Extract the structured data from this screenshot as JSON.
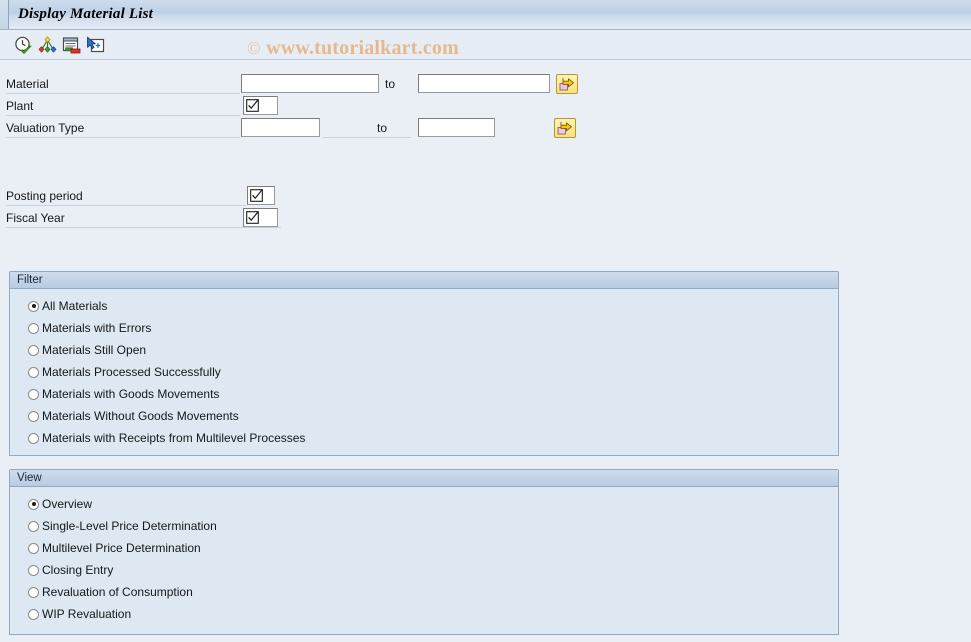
{
  "window": {
    "title": "Display Material List"
  },
  "watermark": {
    "copyright": "©",
    "text": "www.tutorialkart.com"
  },
  "toolbar": {
    "buttons": [
      {
        "name": "execute-icon",
        "tooltip": "Execute",
        "x": 13
      },
      {
        "name": "variant-colors-icon",
        "tooltip": "Get Variant",
        "x": 37
      },
      {
        "name": "save-as-variant-icon",
        "tooltip": "Save as Variant",
        "x": 61
      },
      {
        "name": "select-layout-icon",
        "tooltip": "Select Layout",
        "x": 85
      }
    ]
  },
  "selection": {
    "to_label": "to",
    "rows": [
      {
        "label": "Material",
        "type": "range",
        "from_value": "",
        "to_value": "",
        "has_multi_select": true
      },
      {
        "label": "Plant",
        "type": "checkfield",
        "value": ""
      },
      {
        "label": "Valuation Type",
        "type": "range",
        "from_value": "",
        "to_value": "",
        "has_multi_select": true
      },
      {
        "label": "Posting period",
        "type": "checkfield",
        "value": ""
      },
      {
        "label": "Fiscal Year",
        "type": "checkfield",
        "value": ""
      }
    ]
  },
  "filter_group": {
    "title": "Filter",
    "selected_index": 0,
    "options": [
      "All Materials",
      "Materials with Errors",
      "Materials Still Open",
      "Materials Processed Successfully",
      "Materials with Goods Movements",
      "Materials Without Goods Movements",
      "Materials with Receipts from Multilevel Processes"
    ]
  },
  "view_group": {
    "title": "View",
    "selected_index": 0,
    "options": [
      "Overview",
      "Single-Level Price Determination",
      "Multilevel Price Determination",
      "Closing Entry",
      "Revaluation of Consumption",
      "WIP Revaluation"
    ]
  },
  "colors": {
    "page_background": "#eaeff5",
    "groupbox_body": "#dde8f2",
    "groupbox_header": "#c2d3e7",
    "accent_border": "#8ca9c8",
    "watermark": "#e7b687",
    "button_yellow": "#f6e27c"
  }
}
